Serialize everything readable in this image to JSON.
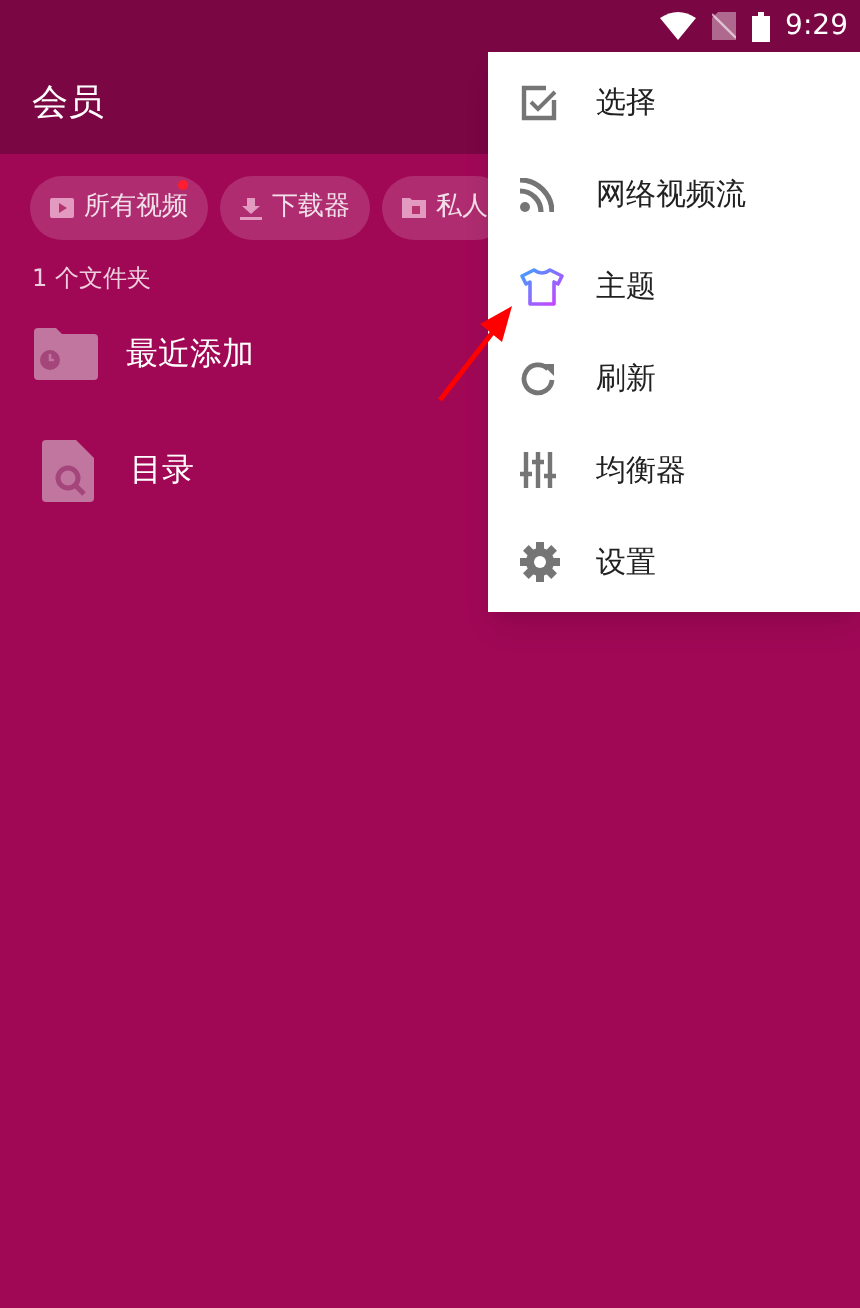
{
  "status_bar": {
    "time": "9:29"
  },
  "app_bar": {
    "title": "会员"
  },
  "chips": [
    {
      "label": "所有视频",
      "badge": true
    },
    {
      "label": "下载器",
      "badge": false
    },
    {
      "label": "私人",
      "badge": false
    }
  ],
  "folder_count": "1 个文件夹",
  "folders": [
    {
      "name": "最近添加",
      "kind": "folder"
    },
    {
      "name": "目录",
      "kind": "file"
    }
  ],
  "menu": [
    {
      "label": "选择"
    },
    {
      "label": "网络视频流"
    },
    {
      "label": "主题"
    },
    {
      "label": "刷新"
    },
    {
      "label": "均衡器"
    },
    {
      "label": "设置"
    }
  ]
}
